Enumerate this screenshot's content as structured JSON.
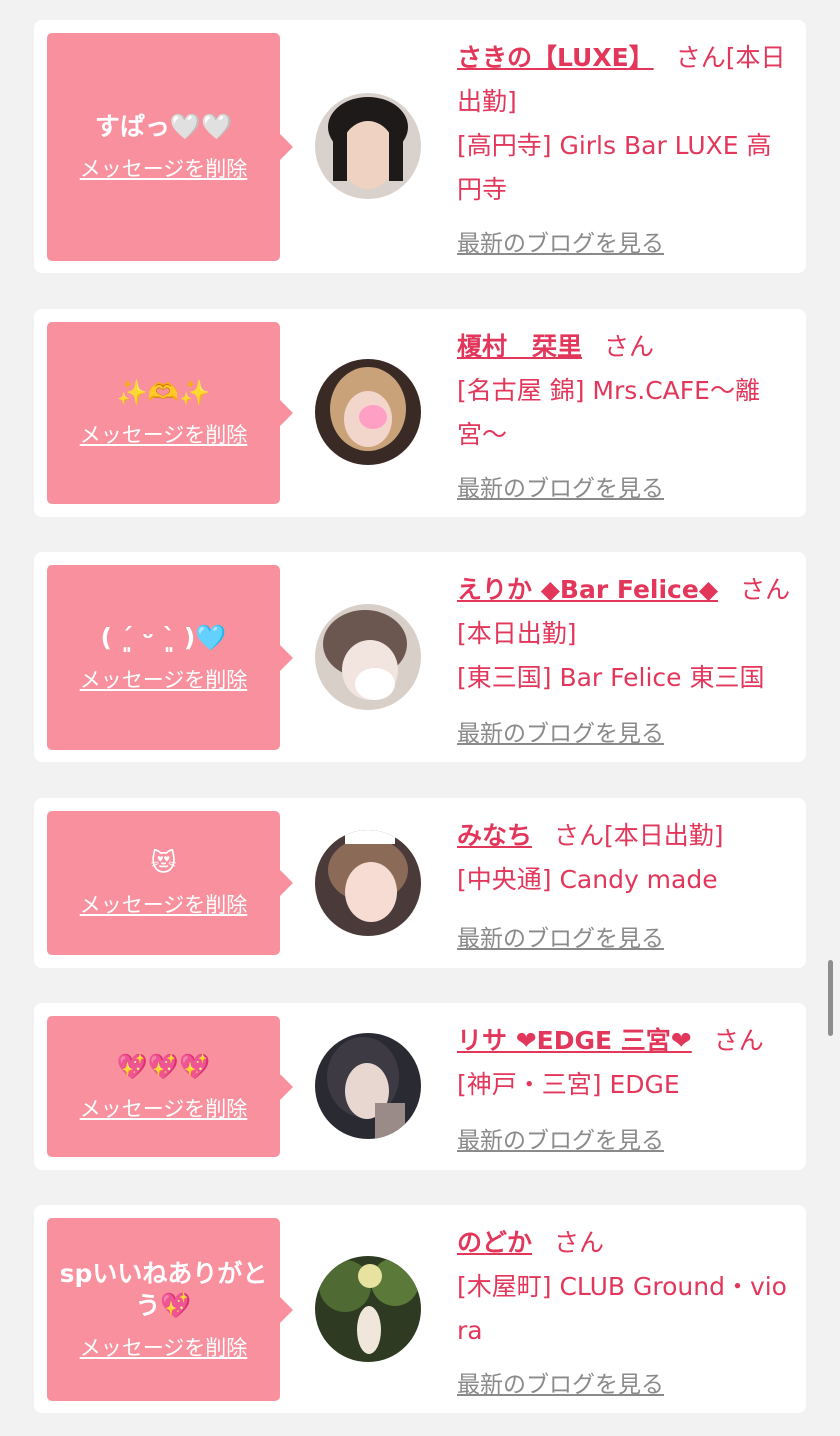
{
  "delete_label": "メッセージを削除",
  "blog_label": "最新のブログを見る",
  "san_label": "さん",
  "colors": {
    "bubble": "#f8909e",
    "accent": "#e2375b",
    "muted": "#8a8a8a",
    "background": "#f2f2f2"
  },
  "cards": [
    {
      "message": "すぱっ🤍🤍",
      "name": "さきの【LUXE】",
      "suffix": "[本日出勤]",
      "shop": "[高円寺] Girls Bar LUXE 高円寺"
    },
    {
      "message": "✨🫶✨",
      "name": "榎村　栞里",
      "suffix": "",
      "shop": "[名古屋 錦] Mrs.CAFE〜離宮〜"
    },
    {
      "message": "( ´͈ ᵕ `͈ )🩵",
      "name": "えりか ◆Bar Felice◆",
      "suffix": "[本日出勤]",
      "shop": "[東三国] Bar Felice 東三国"
    },
    {
      "message": "😻",
      "name": "みなち",
      "suffix": "[本日出勤]",
      "shop": "[中央通] Candy made"
    },
    {
      "message": "💖💖💖",
      "name": "リサ ❤EDGE 三宮❤",
      "suffix": "",
      "shop": "[神戸・三宮] EDGE"
    },
    {
      "message": "spいいねありがとう💖",
      "name": "のどか",
      "suffix": "",
      "shop": "[木屋町] CLUB Ground・viora"
    }
  ]
}
